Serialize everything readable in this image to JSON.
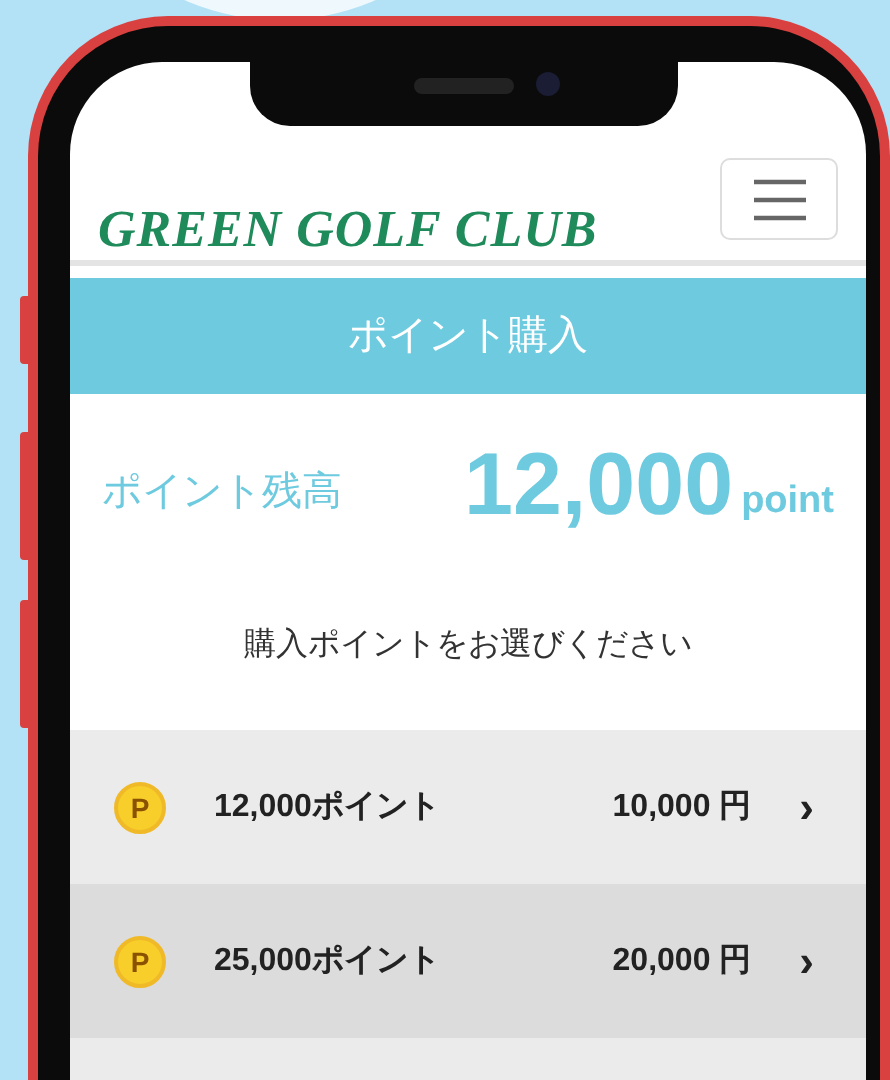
{
  "header": {
    "logo": "GREEN GOLF CLUB"
  },
  "title_bar": {
    "title": "ポイント購入"
  },
  "balance": {
    "label": "ポイント残高",
    "amount": "12,000",
    "unit": "point"
  },
  "instruction": "購入ポイントをお選びください",
  "packages": [
    {
      "coin_mark": "P",
      "points": "12,000ポイント",
      "price": "10,000 円",
      "arrow": "›"
    },
    {
      "coin_mark": "P",
      "points": "25,000ポイント",
      "price": "20,000 円",
      "arrow": "›"
    }
  ]
}
